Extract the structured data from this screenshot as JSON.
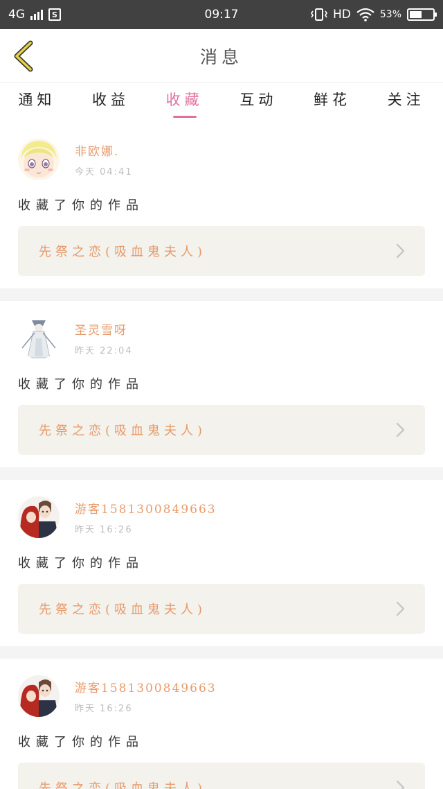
{
  "status_bar": {
    "network": "4G",
    "time": "09:17",
    "hd": "HD",
    "battery": "53%",
    "battery_level": 0.53
  },
  "header": {
    "title": "消息"
  },
  "tabs": [
    {
      "label": "通知",
      "active": false
    },
    {
      "label": "收益",
      "active": false
    },
    {
      "label": "收藏",
      "active": true
    },
    {
      "label": "互动",
      "active": false
    },
    {
      "label": "鲜花",
      "active": false
    },
    {
      "label": "关注",
      "active": false
    }
  ],
  "messages": [
    {
      "username": "非欧娜.",
      "time": "今天 04:41",
      "action": "收藏了你的作品",
      "work_title": "先祭之恋(吸血鬼夫人)",
      "avatar": "anime-girl-blonde-avatar"
    },
    {
      "username": "圣灵雪呀",
      "time": "昨天 22:04",
      "action": "收藏了你的作品",
      "work_title": "先祭之恋(吸血鬼夫人)",
      "avatar": "white-dress-figure-avatar"
    },
    {
      "username": "游客15813008496​63",
      "time": "昨天 16:26",
      "action": "收藏了你的作品",
      "work_title": "先祭之恋(吸血鬼夫人)",
      "avatar": "couple-avatar"
    },
    {
      "username": "游客15813008496​63",
      "time": "昨天 16:26",
      "action": "收藏了你的作品",
      "work_title": "先祭之恋(吸血鬼夫人)",
      "avatar": "couple-avatar"
    }
  ],
  "colors": {
    "accent_pink": "#e36f9f",
    "name_orange": "#e79a6b",
    "card_bg": "#f3f2ec"
  }
}
